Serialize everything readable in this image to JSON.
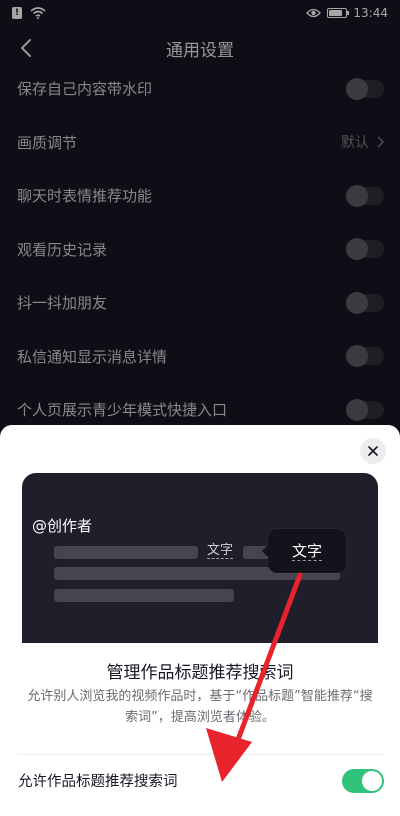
{
  "status_bar": {
    "notification_badge": "!",
    "time": "13:44",
    "icons": [
      "notification-icon",
      "wifi-icon",
      "eye-icon",
      "battery-icon"
    ]
  },
  "header": {
    "title": "通用设置",
    "back_icon": "back-arrow-icon"
  },
  "settings": [
    {
      "label": "保存自己内容带水印",
      "type": "toggle",
      "on": false
    },
    {
      "label": "画质调节",
      "type": "value",
      "value": "默认"
    },
    {
      "label": "聊天时表情推荐功能",
      "type": "toggle",
      "on": false
    },
    {
      "label": "观看历史记录",
      "type": "toggle",
      "on": false
    },
    {
      "label": "抖一抖加朋友",
      "type": "toggle",
      "on": false
    },
    {
      "label": "私信通知显示消息详情",
      "type": "toggle",
      "on": false
    },
    {
      "label": "个人页展示青少年模式快捷入口",
      "type": "toggle",
      "on": false
    }
  ],
  "sheet": {
    "preview": {
      "creator": "@创作者",
      "inline_word": "文字",
      "tooltip_word": "文字"
    },
    "title": "管理作品标题推荐搜索词",
    "description": "允许别人浏览我的视频作品时，基于“作品标题”智能推荐“搜索词”，提高浏览者体验。",
    "allow_label": "允许作品标题推荐搜索词",
    "allow_on": true
  },
  "colors": {
    "background": "#161823",
    "sheet": "#ffffff",
    "toggle_on": "#31c27c",
    "arrow": "#e8232b"
  }
}
